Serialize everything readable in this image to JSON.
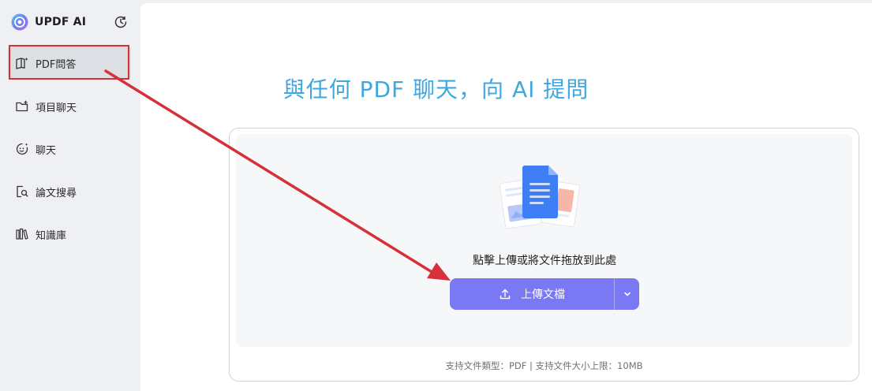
{
  "brand": {
    "name": "UPDF AI",
    "icon": "updf-logo-icon"
  },
  "header": {
    "history_icon": "history-clock-icon"
  },
  "sidebar": {
    "items": [
      {
        "label": "PDF問答",
        "icon": "book-sparkle-icon",
        "active": true
      },
      {
        "label": "項目聊天",
        "icon": "folder-icon"
      },
      {
        "label": "聊天",
        "icon": "chat-face-icon"
      },
      {
        "label": "論文搜尋",
        "icon": "document-search-icon"
      },
      {
        "label": "知識庫",
        "icon": "library-icon"
      }
    ]
  },
  "main": {
    "title": "與任何 PDF 聊天，向 AI 提問",
    "dropzone": {
      "hint": "點擊上傳或將文件拖放到此處",
      "upload_label": "上傳文檔",
      "upload_icon": "upload-icon",
      "more_icon": "chevron-down-icon",
      "support_note": "支持文件類型：PDF  |  支持文件大小上限：10MB"
    }
  },
  "colors": {
    "accent": "#7a78f2",
    "title": "#3fa7e0",
    "annotation": "#d63038",
    "sidebar_bg": "#eef0f3",
    "active_item": "#dcdfe4"
  }
}
